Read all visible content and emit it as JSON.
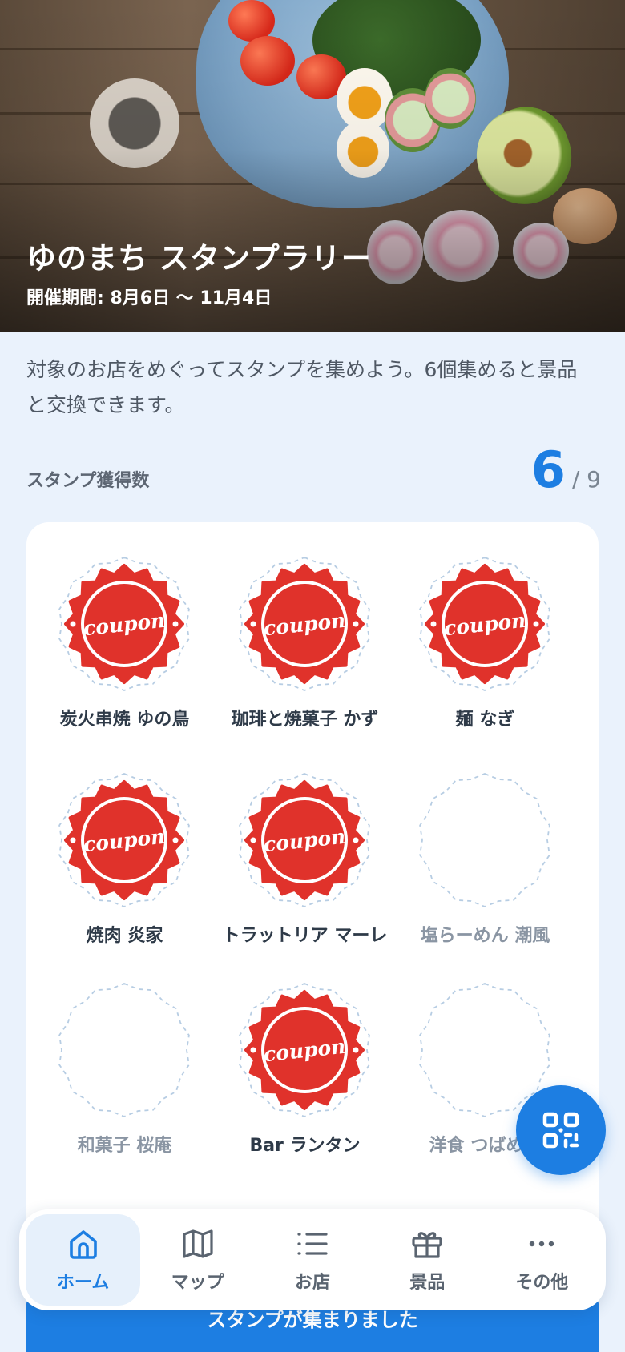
{
  "hero": {
    "title": "ゆのまち スタンプラリー",
    "period": "開催期間: 8月6日 〜 11月4日"
  },
  "intro": "対象のお店をめぐってスタンプを集めよう。6個集めると景品と交換できます。",
  "count": {
    "label": "スタンプ獲得数",
    "value": "6",
    "total": "/ 9"
  },
  "stamp_mark_text": "coupon",
  "stamps": [
    {
      "name": "炭火串焼 ゆの鳥",
      "collected": true
    },
    {
      "name": "珈琲と焼菓子 かず",
      "collected": true
    },
    {
      "name": "麺 なぎ",
      "collected": true
    },
    {
      "name": "焼肉 炎家",
      "collected": true
    },
    {
      "name": "トラットリア マーレ",
      "collected": true
    },
    {
      "name": "塩らーめん 潮風",
      "collected": false
    },
    {
      "name": "和菓子 桜庵",
      "collected": false
    },
    {
      "name": "Bar ランタン",
      "collected": true
    },
    {
      "name": "洋食 つばめ亭",
      "collected": false
    }
  ],
  "banner": {
    "text": "スタンプが集まりました"
  },
  "nav": [
    {
      "label": "ホーム",
      "icon": "home-icon",
      "active": true
    },
    {
      "label": "マップ",
      "icon": "map-icon",
      "active": false
    },
    {
      "label": "お店",
      "icon": "list-icon",
      "active": false
    },
    {
      "label": "景品",
      "icon": "gift-icon",
      "active": false
    },
    {
      "label": "その他",
      "icon": "more-icon",
      "active": false
    }
  ],
  "fab": {
    "icon": "qr-code-icon"
  },
  "colors": {
    "accent": "#1d7ee2",
    "stamp_red": "#e0322b",
    "background": "#eaf2fc"
  }
}
